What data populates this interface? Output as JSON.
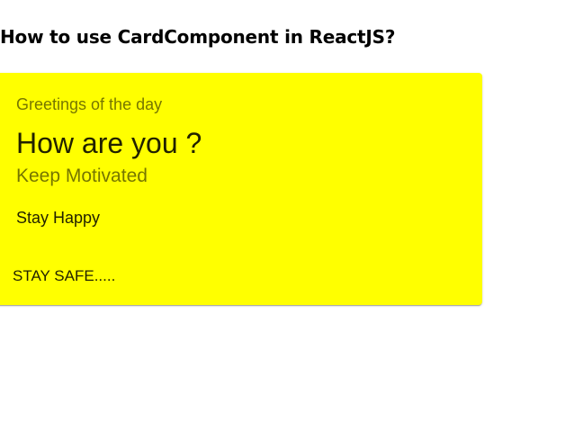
{
  "page": {
    "heading": "How to use CardComponent in ReactJS?"
  },
  "card": {
    "background_color": "#ffff00",
    "greeting": "Greetings of the day",
    "question": "How are you ?",
    "subtitle": "Keep Motivated",
    "body": "Stay Happy",
    "action_label": "STAY SAFE....."
  }
}
